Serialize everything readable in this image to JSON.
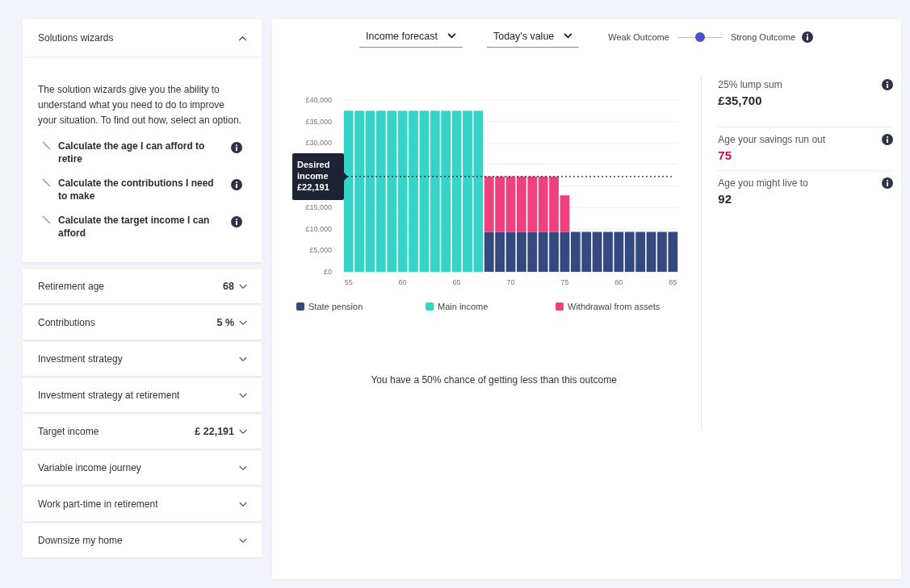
{
  "wizards": {
    "title": "Solutions wizards",
    "expanded": true,
    "intro": "The solution wizards give you the ability to understand what you need to do to improve your situation. To find out how, select an option.",
    "items": [
      {
        "label": "Calculate the age I can afford to retire"
      },
      {
        "label": "Calculate the contributions I need to make"
      },
      {
        "label": "Calculate the target income I can afford"
      }
    ]
  },
  "settings": [
    {
      "label": "Retirement age",
      "value": "68"
    },
    {
      "label": "Contributions",
      "value": "5 %"
    },
    {
      "label": "Investment strategy"
    },
    {
      "label": "Investment strategy at retirement"
    },
    {
      "label": "Target income",
      "value": "£ 22,191"
    },
    {
      "label": "Variable income journey"
    },
    {
      "label": "Work part-time in retirement"
    },
    {
      "label": "Downsize my home"
    }
  ],
  "controls": {
    "view": "Income forecast",
    "value_basis": "Today's value",
    "outcome": {
      "low_label": "Weak Outcome",
      "high_label": "Strong Outcome",
      "level": 0.5
    }
  },
  "forecast": {
    "chart_data": {
      "type": "bar",
      "stacked": true,
      "grid": true,
      "x": [
        55,
        56,
        57,
        58,
        59,
        60,
        61,
        62,
        63,
        64,
        65,
        66,
        67,
        68,
        69,
        70,
        71,
        72,
        73,
        74,
        75,
        76,
        77,
        78,
        79,
        80,
        81,
        82,
        83,
        84,
        85
      ],
      "series": [
        {
          "name": "State pension",
          "color": "#34497f",
          "values": [
            0,
            0,
            0,
            0,
            0,
            0,
            0,
            0,
            0,
            0,
            0,
            0,
            0,
            9300,
            9300,
            9300,
            9300,
            9300,
            9300,
            9300,
            9300,
            9300,
            9300,
            9300,
            9300,
            9300,
            9300,
            9300,
            9300,
            9300,
            9300
          ]
        },
        {
          "name": "Main income",
          "color": "#36d4c8",
          "values": [
            37500,
            37500,
            37500,
            37500,
            37500,
            37500,
            37500,
            37500,
            37500,
            37500,
            37500,
            37500,
            37500,
            0,
            0,
            0,
            0,
            0,
            0,
            0,
            0,
            0,
            0,
            0,
            0,
            0,
            0,
            0,
            0,
            0,
            0
          ]
        },
        {
          "name": "Withdrawal from assets",
          "color": "#f0417f",
          "values": [
            0,
            0,
            0,
            0,
            0,
            0,
            0,
            0,
            0,
            0,
            0,
            0,
            0,
            12900,
            12900,
            12900,
            12900,
            12900,
            12900,
            12900,
            8500,
            0,
            0,
            0,
            0,
            0,
            0,
            0,
            0,
            0,
            0
          ]
        }
      ],
      "ylim": [
        0,
        40000
      ],
      "yticks": [
        {
          "value": 0,
          "label": "£0"
        },
        {
          "value": 5000,
          "label": "£5,000"
        },
        {
          "value": 10000,
          "label": "£10,000"
        },
        {
          "value": 15000,
          "label": "£15,000"
        },
        {
          "value": 30000,
          "label": "£30,000"
        },
        {
          "value": 35000,
          "label": "£35,000"
        },
        {
          "value": 40000,
          "label": "£40,000"
        }
      ],
      "xlim": [
        54.5,
        85.5
      ],
      "xticks": [
        55,
        60,
        65,
        70,
        75,
        80,
        85
      ],
      "ref_lines": [
        {
          "axis": "y",
          "value": 22191,
          "label": "Desired income £22,191"
        }
      ]
    },
    "note": "You have a 50% chance of getting less than this outcome"
  },
  "stats": [
    {
      "label": "25% lump sum",
      "value": "£35,700",
      "alert": false
    },
    {
      "label": "Age your savings run out",
      "value": "75",
      "alert": true
    },
    {
      "label": "Age you might live to",
      "value": "92",
      "alert": false
    }
  ]
}
